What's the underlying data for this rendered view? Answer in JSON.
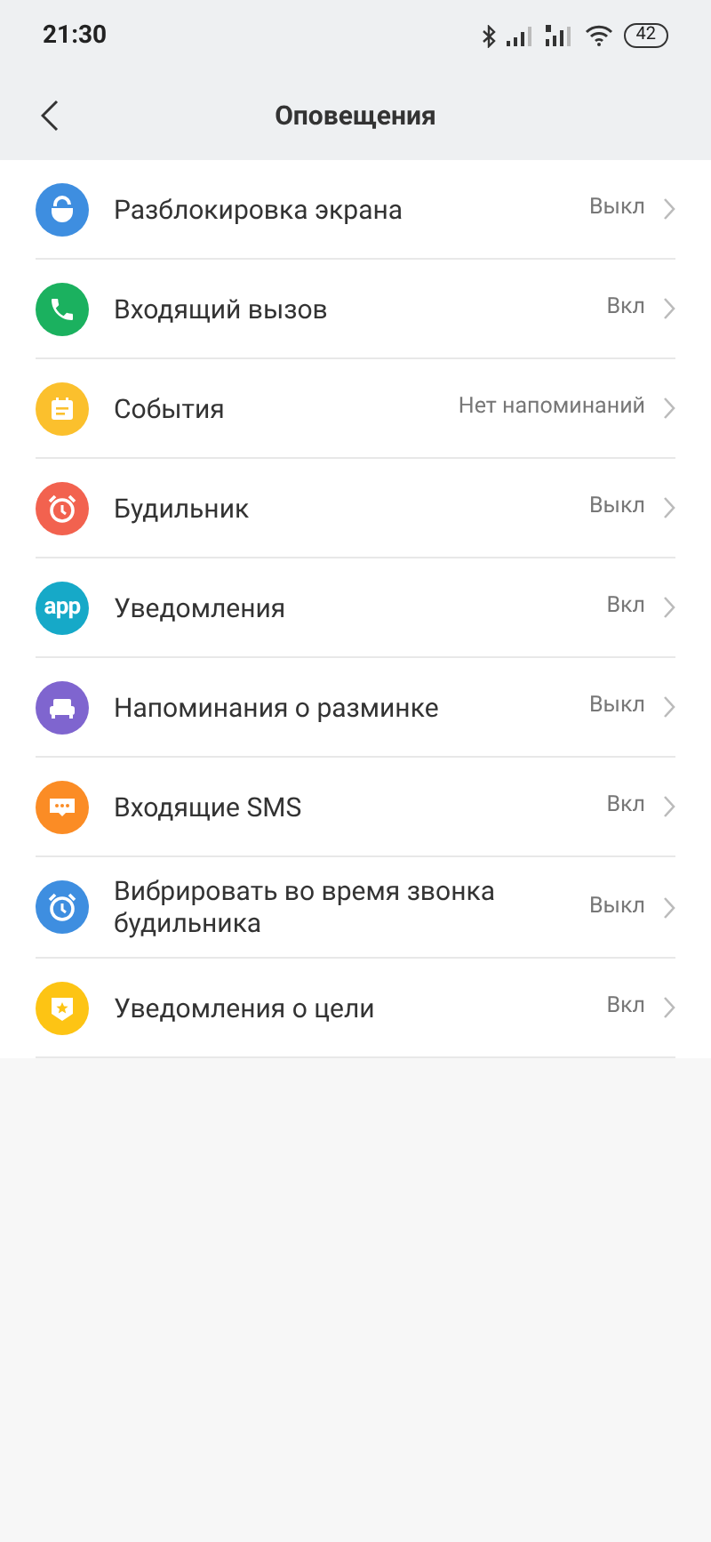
{
  "status_bar": {
    "time": "21:30",
    "battery": "42"
  },
  "header": {
    "title": "Оповещения"
  },
  "items": [
    {
      "kind": "lock",
      "color": "#3e8ee0",
      "label": "Разблокировка экрана",
      "value": "Выкл"
    },
    {
      "kind": "phone",
      "color": "#1bb15f",
      "label": "Входящий вызов",
      "value": "Вкл"
    },
    {
      "kind": "calendar",
      "color": "#fbc02d",
      "label": "События",
      "value": "Нет напоминаний"
    },
    {
      "kind": "alarm",
      "color": "#f2624f",
      "label": "Будильник",
      "value": "Выкл"
    },
    {
      "kind": "app",
      "color": "#16a9c8",
      "icon_text": "app",
      "label": "Уведомления",
      "value": "Вкл"
    },
    {
      "kind": "sofa",
      "color": "#7f65cf",
      "label": "Напоминания о разминке",
      "value": "Выкл"
    },
    {
      "kind": "message",
      "color": "#fb8c25",
      "label": "Входящие SMS",
      "value": "Вкл"
    },
    {
      "kind": "alarm",
      "color": "#3e8ee0",
      "label": "Вибрировать во время звонка будильника",
      "value": "Выкл"
    },
    {
      "kind": "star",
      "color": "#fdc414",
      "label": "Уведомления о цели",
      "value": "Вкл"
    }
  ]
}
